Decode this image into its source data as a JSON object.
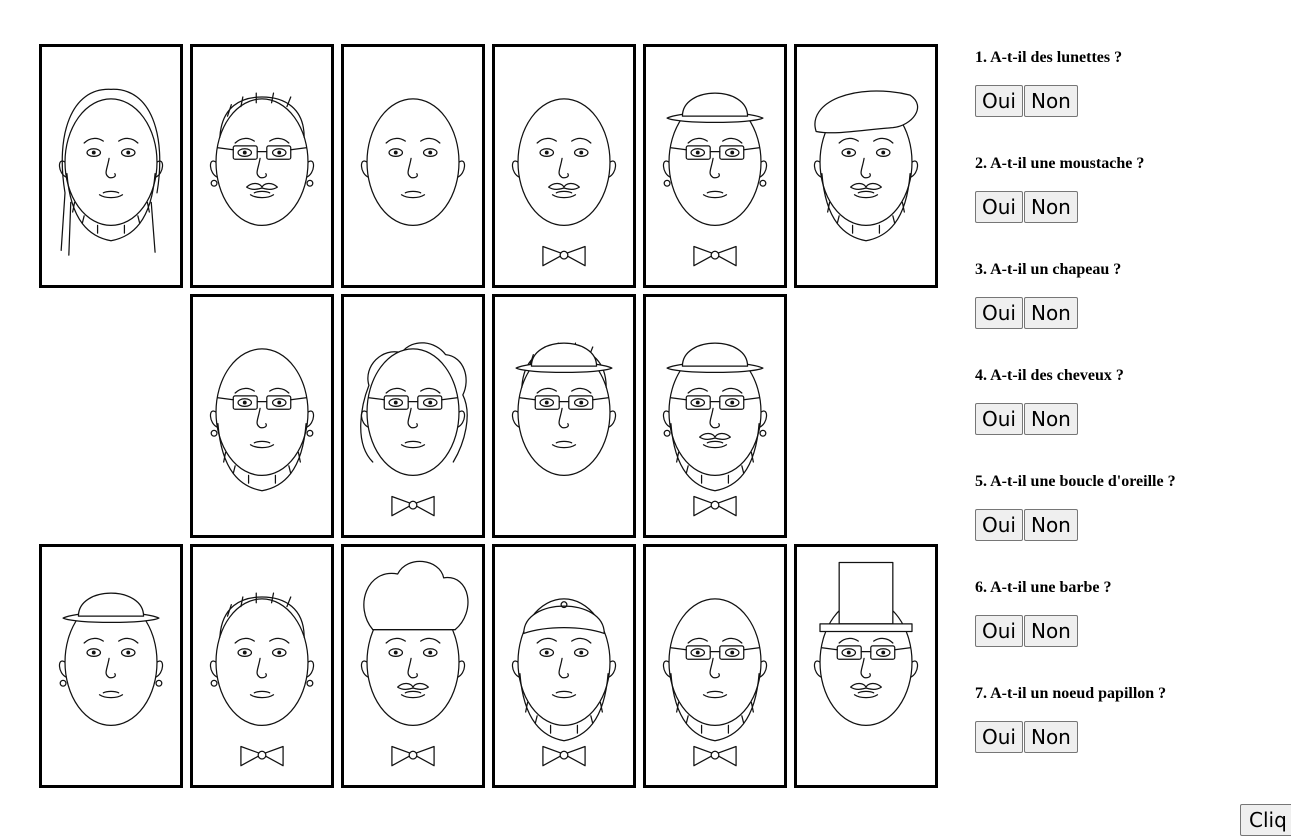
{
  "cards": [
    {
      "id": "1",
      "features": [
        "long-hair",
        "beard"
      ]
    },
    {
      "id": "2",
      "features": [
        "glasses",
        "moustache",
        "earrings",
        "short-hair"
      ]
    },
    {
      "id": "3",
      "features": [
        "bald"
      ]
    },
    {
      "id": "4",
      "features": [
        "moustache",
        "bow-tie",
        "bald"
      ]
    },
    {
      "id": "5",
      "features": [
        "glasses",
        "hat",
        "bow-tie",
        "earrings"
      ]
    },
    {
      "id": "6",
      "features": [
        "beret",
        "moustache",
        "beard"
      ]
    },
    {
      "id": "7",
      "features": [
        "glasses",
        "beard",
        "earrings",
        "bald"
      ]
    },
    {
      "id": "8",
      "features": [
        "glasses",
        "curly-hair",
        "bow-tie"
      ]
    },
    {
      "id": "9",
      "features": [
        "hat",
        "short-hair",
        "glasses"
      ]
    },
    {
      "id": "10",
      "features": [
        "hat",
        "glasses",
        "moustache",
        "beard",
        "bow-tie",
        "earrings"
      ]
    },
    {
      "id": "11",
      "features": [
        "hat",
        "earrings"
      ]
    },
    {
      "id": "12",
      "features": [
        "short-hair",
        "bow-tie",
        "earrings"
      ]
    },
    {
      "id": "13",
      "features": [
        "chef-hat",
        "moustache",
        "bow-tie"
      ]
    },
    {
      "id": "14",
      "features": [
        "cap",
        "beard",
        "bow-tie"
      ]
    },
    {
      "id": "15",
      "features": [
        "glasses",
        "beard",
        "bow-tie",
        "bald"
      ]
    },
    {
      "id": "16",
      "features": [
        "top-hat",
        "glasses",
        "moustache"
      ]
    }
  ],
  "questions": [
    {
      "label": "1. A-t-il des lunettes ?",
      "yes": "Oui",
      "no": "Non"
    },
    {
      "label": "2. A-t-il une moustache ?",
      "yes": "Oui",
      "no": "Non"
    },
    {
      "label": "3. A-t-il un chapeau ?",
      "yes": "Oui",
      "no": "Non"
    },
    {
      "label": "4. A-t-il des cheveux ?",
      "yes": "Oui",
      "no": "Non"
    },
    {
      "label": "5. A-t-il une boucle d'oreille ?",
      "yes": "Oui",
      "no": "Non"
    },
    {
      "label": "6. A-t-il une barbe ?",
      "yes": "Oui",
      "no": "Non"
    },
    {
      "label": "7. A-t-il un noeud papillon ?",
      "yes": "Oui",
      "no": "Non"
    }
  ],
  "submit_label": "Cliq"
}
